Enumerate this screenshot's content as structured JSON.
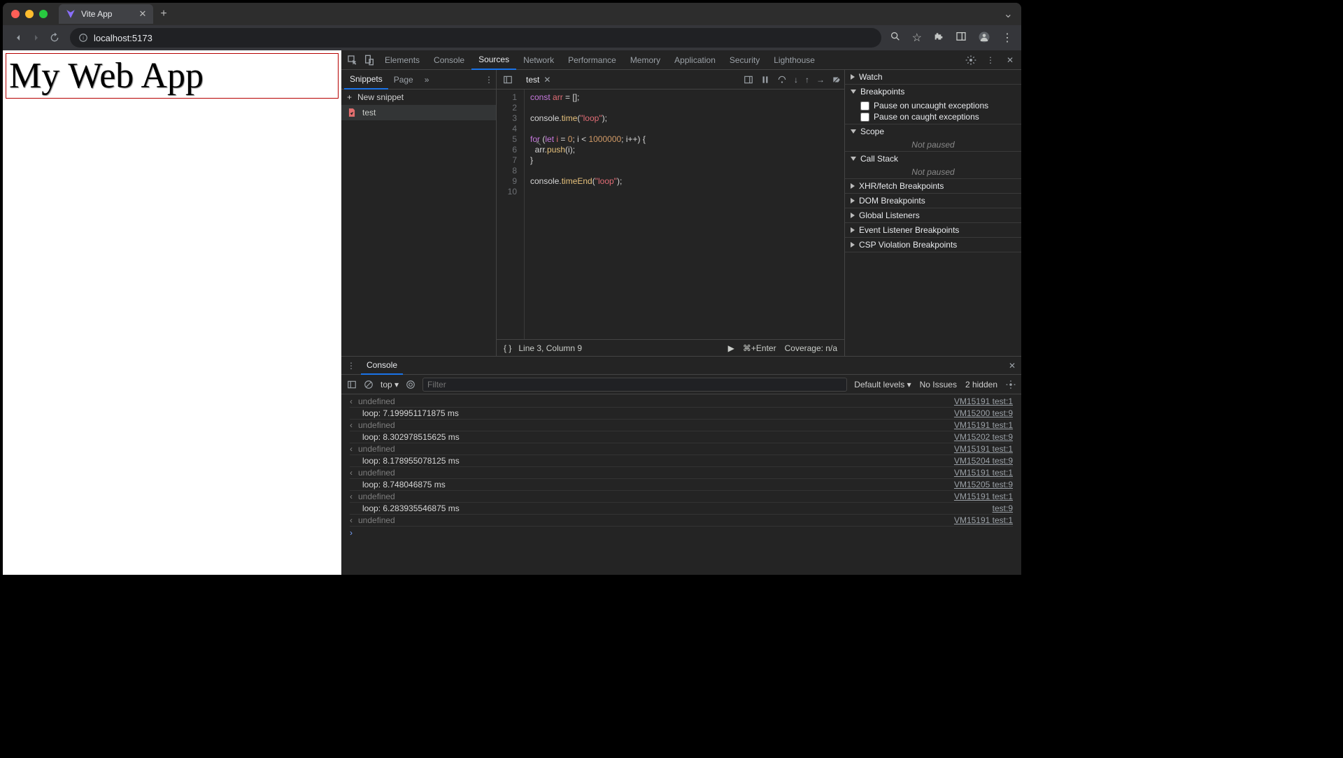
{
  "tab": {
    "title": "Vite App"
  },
  "url": "localhost:5173",
  "page_heading": "My Web App",
  "devtools": {
    "tabs": [
      "Elements",
      "Console",
      "Sources",
      "Network",
      "Performance",
      "Memory",
      "Application",
      "Security",
      "Lighthouse"
    ],
    "active_tab": "Sources",
    "subtabs": [
      "Snippets",
      "Page"
    ],
    "active_subtab": "Snippets",
    "new_snippet_label": "New snippet",
    "snippet_name": "test",
    "editor_tab": "test",
    "code_lines": [
      "const arr = [];",
      "",
      "console.time(\"loop\");",
      "",
      "for (let i = 0; i < 1000000; i++) {",
      "  arr.push(i);",
      "}",
      "",
      "console.timeEnd(\"loop\");",
      ""
    ],
    "line_numbers": [
      "1",
      "2",
      "3",
      "4",
      "5",
      "6",
      "7",
      "8",
      "9",
      "10"
    ],
    "status_line": "Line 3, Column 9",
    "run_hint": "⌘+Enter",
    "coverage": "Coverage: n/a"
  },
  "debugger": {
    "watch": "Watch",
    "breakpoints": "Breakpoints",
    "pause_uncaught": "Pause on uncaught exceptions",
    "pause_caught": "Pause on caught exceptions",
    "scope": "Scope",
    "not_paused": "Not paused",
    "call_stack": "Call Stack",
    "xhr": "XHR/fetch Breakpoints",
    "dom": "DOM Breakpoints",
    "listeners": "Global Listeners",
    "event_bp": "Event Listener Breakpoints",
    "csp": "CSP Violation Breakpoints"
  },
  "console": {
    "tab": "Console",
    "context": "top",
    "filter_placeholder": "Filter",
    "levels": "Default levels",
    "no_issues": "No Issues",
    "hidden": "2 hidden",
    "logs": [
      {
        "type": "undefined",
        "msg": "undefined",
        "src": "VM15191 test:1"
      },
      {
        "type": "loop",
        "msg": "loop: 7.199951171875 ms",
        "src": "VM15200 test:9"
      },
      {
        "type": "undefined",
        "msg": "undefined",
        "src": "VM15191 test:1"
      },
      {
        "type": "loop",
        "msg": "loop: 8.302978515625 ms",
        "src": "VM15202 test:9"
      },
      {
        "type": "undefined",
        "msg": "undefined",
        "src": "VM15191 test:1"
      },
      {
        "type": "loop",
        "msg": "loop: 8.178955078125 ms",
        "src": "VM15204 test:9"
      },
      {
        "type": "undefined",
        "msg": "undefined",
        "src": "VM15191 test:1"
      },
      {
        "type": "loop",
        "msg": "loop: 8.748046875 ms",
        "src": "VM15205 test:9"
      },
      {
        "type": "undefined",
        "msg": "undefined",
        "src": "VM15191 test:1"
      },
      {
        "type": "loop",
        "msg": "loop: 6.283935546875 ms",
        "src": "test:9"
      },
      {
        "type": "undefined",
        "msg": "undefined",
        "src": "VM15191 test:1"
      }
    ]
  }
}
